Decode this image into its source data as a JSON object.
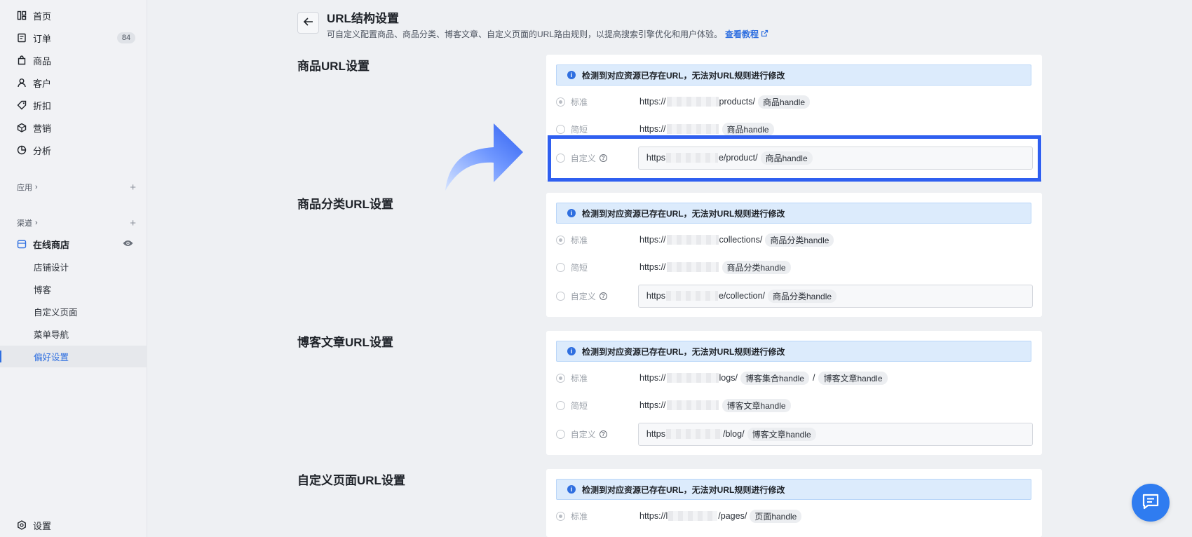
{
  "sidebar": {
    "items": [
      {
        "label": "首页",
        "icon": "home-icon"
      },
      {
        "label": "订单",
        "icon": "order-icon",
        "badge": "84"
      },
      {
        "label": "商品",
        "icon": "product-icon"
      },
      {
        "label": "客户",
        "icon": "customer-icon"
      },
      {
        "label": "折扣",
        "icon": "discount-icon"
      },
      {
        "label": "营销",
        "icon": "marketing-icon"
      },
      {
        "label": "分析",
        "icon": "analytics-icon"
      }
    ],
    "apps_label": "应用",
    "channels_label": "渠道",
    "online_store": "在线商店",
    "sub_items": [
      "店铺设计",
      "博客",
      "自定义页面",
      "菜单导航",
      "偏好设置"
    ],
    "settings_label": "设置"
  },
  "header": {
    "title": "URL结构设置",
    "description": "可自定义配置商品、商品分类、博客文章、自定义页面的URL路由规则，以提高搜索引擎优化和用户体验。",
    "tutorial_link": "查看教程"
  },
  "alert_text": "检测到对应资源已存在URL，无法对URL规则进行修改",
  "option_labels": {
    "standard": "标准",
    "short": "简短",
    "custom": "自定义"
  },
  "sections": {
    "product": {
      "title": "商品URL设置",
      "standard_prefix": "https://",
      "standard_path": "products/",
      "standard_tag": "商品handle",
      "short_prefix": "https://",
      "short_tag": "商品handle",
      "custom_prefix": "https",
      "custom_path": "e/product/",
      "custom_tag": "商品handle"
    },
    "collection": {
      "title": "商品分类URL设置",
      "standard_prefix": "https://",
      "standard_path": "collections/",
      "standard_tag": "商品分类handle",
      "short_prefix": "https://",
      "short_tag": "商品分类handle",
      "custom_prefix": "https",
      "custom_path": "e/collection/",
      "custom_tag": "商品分类handle"
    },
    "blog": {
      "title": "博客文章URL设置",
      "standard_prefix": "https://",
      "standard_path": "logs/",
      "standard_tag": "博客集合handle",
      "standard_sep": "/",
      "standard_tag2": "博客文章handle",
      "short_prefix": "https://",
      "short_tag": "博客文章handle",
      "custom_prefix": "https",
      "custom_path": "/blog/",
      "custom_tag": "博客文章handle"
    },
    "page": {
      "title": "自定义页面URL设置",
      "standard_prefix": "https://l",
      "standard_path": "/pages/",
      "standard_tag": "页面handle"
    }
  },
  "colors": {
    "accent": "#2f6fe0",
    "highlight": "#2f5ff0",
    "chat": "#2f7cf0"
  }
}
